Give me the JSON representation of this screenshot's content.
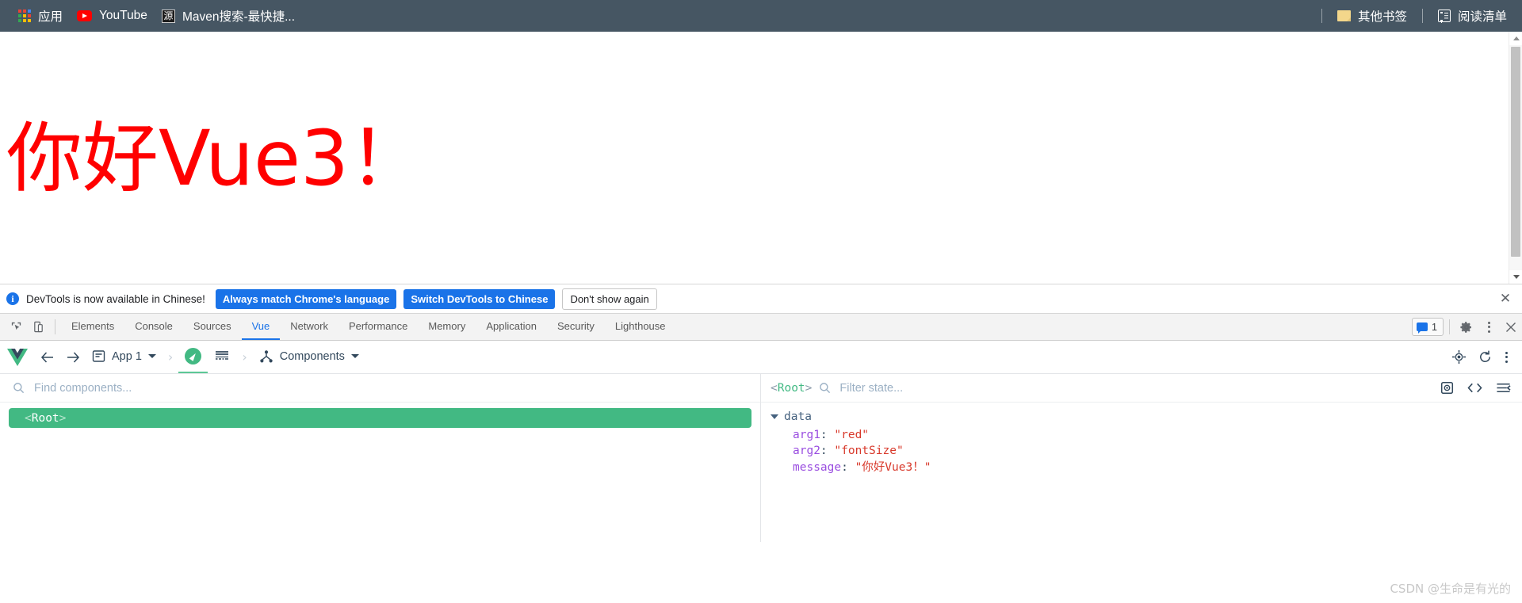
{
  "browser": {
    "bookmarks": [
      {
        "label": "应用",
        "icon": "apps-grid-icon"
      },
      {
        "label": "YouTube",
        "icon": "youtube-icon"
      },
      {
        "label": "Maven搜索-最快捷...",
        "icon": "source-icon",
        "icon_glyph": "源"
      }
    ],
    "other_bookmarks": {
      "label": "其他书签",
      "icon": "folder-icon"
    },
    "reading_list": {
      "label": "阅读清单",
      "icon": "reading-list-icon"
    },
    "bar_background": "#465663"
  },
  "page": {
    "heading": "你好Vue3！",
    "heading_color": "#ff0000",
    "scrollbar": {
      "up_arrow": "▲",
      "down_arrow": "▼"
    }
  },
  "notification": {
    "icon": "info-icon",
    "icon_glyph": "i",
    "message": "DevTools is now available in Chinese!",
    "buttons": [
      {
        "label": "Always match Chrome's language",
        "style": "primary"
      },
      {
        "label": "Switch DevTools to Chinese",
        "style": "primary"
      },
      {
        "label": "Don't show again",
        "style": "secondary"
      }
    ],
    "close_label": "✕",
    "primary_color": "#1a73e8"
  },
  "devtools": {
    "left_icons": [
      {
        "name": "inspect-element-icon"
      },
      {
        "name": "device-toolbar-icon"
      }
    ],
    "tabs": [
      {
        "label": "Elements",
        "active": false
      },
      {
        "label": "Console",
        "active": false
      },
      {
        "label": "Sources",
        "active": false
      },
      {
        "label": "Vue",
        "active": true
      },
      {
        "label": "Network",
        "active": false
      },
      {
        "label": "Performance",
        "active": false
      },
      {
        "label": "Memory",
        "active": false
      },
      {
        "label": "Application",
        "active": false
      },
      {
        "label": "Security",
        "active": false
      },
      {
        "label": "Lighthouse",
        "active": false
      }
    ],
    "issues_count": "1",
    "settings_icon": "gear-icon",
    "more_icon": "kebab-menu-icon",
    "close_icon": "close-icon",
    "active_tab_color": "#1a73e8"
  },
  "vue_toolbar": {
    "logo": "vue-logo",
    "back_label": "←",
    "forward_label": "→",
    "app_selector": "App 1",
    "separator": "›",
    "components_label": "Components",
    "right_icons": [
      {
        "name": "select-component-icon"
      },
      {
        "name": "refresh-icon"
      },
      {
        "name": "kebab-menu-icon"
      }
    ],
    "accent_color": "#42b983"
  },
  "components_pane": {
    "search_placeholder": "Find components...",
    "search_value": "",
    "tree": [
      {
        "bracket_open": "<",
        "name": "Root",
        "bracket_close": ">",
        "selected": true
      }
    ]
  },
  "state_pane": {
    "selected_component": {
      "bracket_open": "<",
      "name": "Root",
      "bracket_close": ">"
    },
    "filter_placeholder": "Filter state...",
    "filter_value": "",
    "icons": [
      {
        "name": "inspect-dom-icon"
      },
      {
        "name": "open-in-editor-icon"
      },
      {
        "name": "collapse-all-icon"
      }
    ],
    "groups": [
      {
        "name": "data",
        "expanded": true,
        "entries": [
          {
            "key": "arg1",
            "value": "\"red\""
          },
          {
            "key": "arg2",
            "value": "\"fontSize\""
          },
          {
            "key": "message",
            "value": "\"你好Vue3！\""
          }
        ]
      }
    ]
  },
  "watermark": "CSDN @生命是有光的"
}
